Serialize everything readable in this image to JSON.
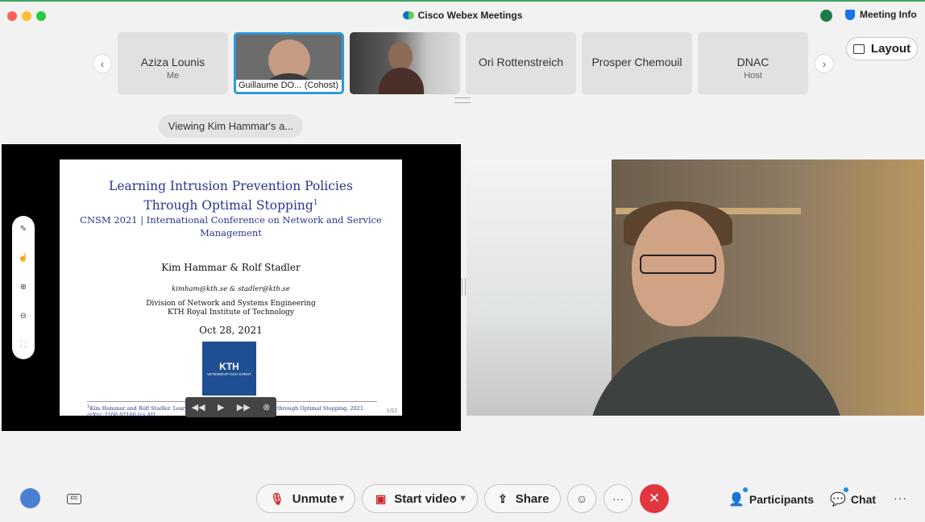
{
  "window": {
    "title": "Cisco Webex Meetings",
    "meeting_info": "Meeting Info"
  },
  "strip": {
    "participants": [
      {
        "name": "Aziza Lounis",
        "role": "Me"
      },
      {
        "name": "Guillaume DO...",
        "role": "(Cohost)"
      },
      {
        "name": "",
        "role": ""
      },
      {
        "name": "Ori Rottenstreich",
        "role": ""
      },
      {
        "name": "Prosper Chemouil",
        "role": ""
      },
      {
        "name": "DNAC",
        "role": "Host"
      }
    ],
    "layout_label": "Layout"
  },
  "viewing_label": "Viewing Kim Hammar's a...",
  "slide": {
    "title_line1": "Learning Intrusion Prevention Policies",
    "title_line2": "Through Optimal Stopping",
    "footnote_mark": "1",
    "conference_line1": "CNSM 2021 | International Conference on Network and Service",
    "conference_line2": "Management",
    "authors": "Kim Hammar & Rolf Stadler",
    "emails": "kimham@kth.se & stadler@kth.se",
    "division": "Division of Network and Systems Engineering",
    "institute": "KTH Royal Institute of Technology",
    "date": "Oct 28, 2021",
    "logo_text": "KTH",
    "logo_sub": "VETENSKAP OCH KONST",
    "footnote": "Kim Hammar and Rolf Stadler. Learning Intrusion Prevention Policies through Optimal Stopping. 2021. arXiv: 2106.07160 [cs.AI].",
    "page_number": "1/23"
  },
  "controls": {
    "unmute": "Unmute",
    "start_video": "Start video",
    "share": "Share",
    "participants": "Participants",
    "chat": "Chat"
  }
}
